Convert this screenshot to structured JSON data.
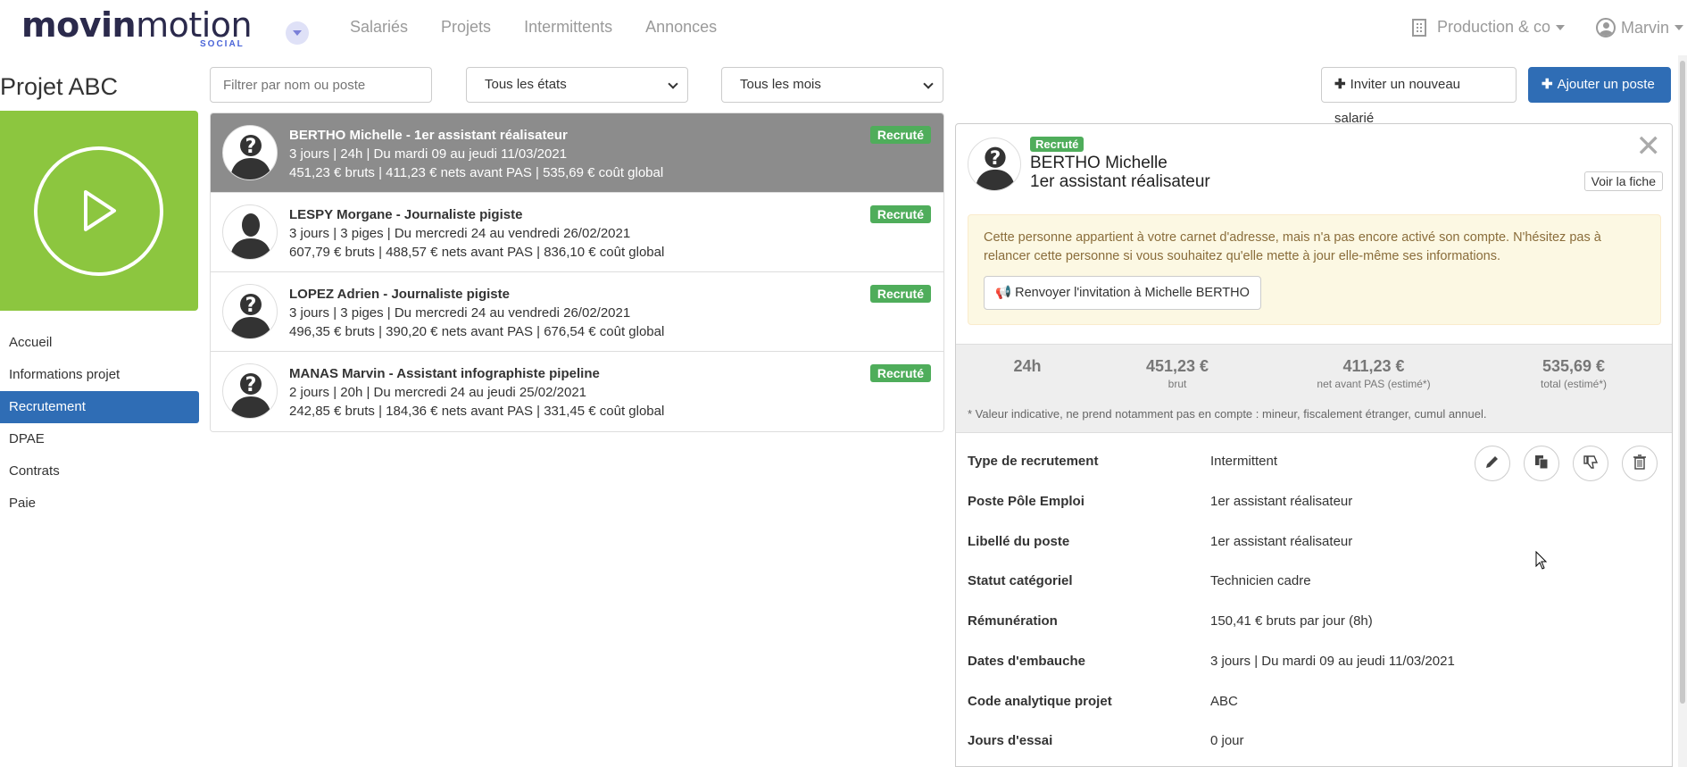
{
  "brand": {
    "name_bold": "movin",
    "name_light": "motion",
    "sub": "SOCIAL"
  },
  "nav": {
    "items": [
      "Salariés",
      "Projets",
      "Intermittents",
      "Annonces"
    ]
  },
  "org": {
    "label": "Production & co"
  },
  "user": {
    "label": "Marvin"
  },
  "project": {
    "title": "Projet ABC"
  },
  "sidebar": {
    "items": [
      {
        "label": "Accueil"
      },
      {
        "label": "Informations projet"
      },
      {
        "label": "Recrutement"
      },
      {
        "label": "DPAE"
      },
      {
        "label": "Contrats"
      },
      {
        "label": "Paie"
      }
    ],
    "active": "Recrutement"
  },
  "filters": {
    "search_placeholder": "Filtrer par nom ou poste",
    "state_select": "Tous les états",
    "month_select": "Tous les mois"
  },
  "actions": {
    "invite_label": "Inviter un nouveau salarié",
    "add_label": "Ajouter un poste"
  },
  "candidates": [
    {
      "name": "BERTHO Michelle - 1er assistant réalisateur",
      "line1": "3 jours | 24h | Du mardi 09 au jeudi 11/03/2021",
      "line2": "451,23 € bruts | 411,23 € nets avant PAS | 535,69 € coût global",
      "badge": "Recruté"
    },
    {
      "name": "LESPY Morgane - Journaliste pigiste",
      "line1": "3 jours | 3 piges | Du mercredi 24 au vendredi 26/02/2021",
      "line2": "607,79 € bruts | 488,57 € nets avant PAS | 836,10 € coût global",
      "badge": "Recruté"
    },
    {
      "name": "LOPEZ Adrien - Journaliste pigiste",
      "line1": "3 jours | 3 piges | Du mercredi 24 au vendredi 26/02/2021",
      "line2": "496,35 € bruts | 390,20 € nets avant PAS | 676,54 € coût global",
      "badge": "Recruté"
    },
    {
      "name": "MANAS Marvin - Assistant infographiste pipeline",
      "line1": "2 jours | 20h | Du mercredi 24 au jeudi 25/02/2021",
      "line2": "242,85 € bruts | 184,36 € nets avant PAS | 331,45 € coût global",
      "badge": "Recruté"
    }
  ],
  "detail": {
    "badge": "Recruté",
    "name": "BERTHO Michelle",
    "role": "1er assistant réalisateur",
    "close": "✕",
    "voir_label": "Voir la fiche",
    "alert_text": "Cette personne appartient à votre carnet d'adresse, mais n'a pas encore activé son compte. N'hésitez pas à relancer cette personne si vous souhaitez qu'elle mette à jour elle-même ses informations.",
    "resend_label": "Renvoyer l'invitation à Michelle BERTHO",
    "stats": [
      {
        "value": "24h",
        "label": ""
      },
      {
        "value": "451,23 €",
        "label": "brut"
      },
      {
        "value": "411,23 €",
        "label": "net avant PAS (estimé*)"
      },
      {
        "value": "535,69 €",
        "label": "total (estimé*)"
      }
    ],
    "note": "* Valeur indicative, ne prend notamment pas en compte : mineur, fiscalement étranger, cumul annuel.",
    "fields": [
      {
        "key": "Type de recrutement",
        "value": "Intermittent"
      },
      {
        "key": "Poste Pôle Emploi",
        "value": "1er assistant réalisateur"
      },
      {
        "key": "Libellé du poste",
        "value": "1er assistant réalisateur"
      },
      {
        "key": "Statut catégoriel",
        "value": "Technicien cadre"
      },
      {
        "key": "Rémunération",
        "value": "150,41 € bruts par jour (8h)"
      },
      {
        "key": "Dates d'embauche",
        "value": "3 jours | Du mardi 09 au jeudi 11/03/2021"
      },
      {
        "key": "Code analytique projet",
        "value": "ABC"
      },
      {
        "key": "Jours d'essai",
        "value": "0 jour"
      }
    ]
  },
  "colors": {
    "primary": "#2f6db5",
    "success": "#4fad5b",
    "tile": "#8cc63f",
    "selected_row": "#8c8c8c"
  }
}
